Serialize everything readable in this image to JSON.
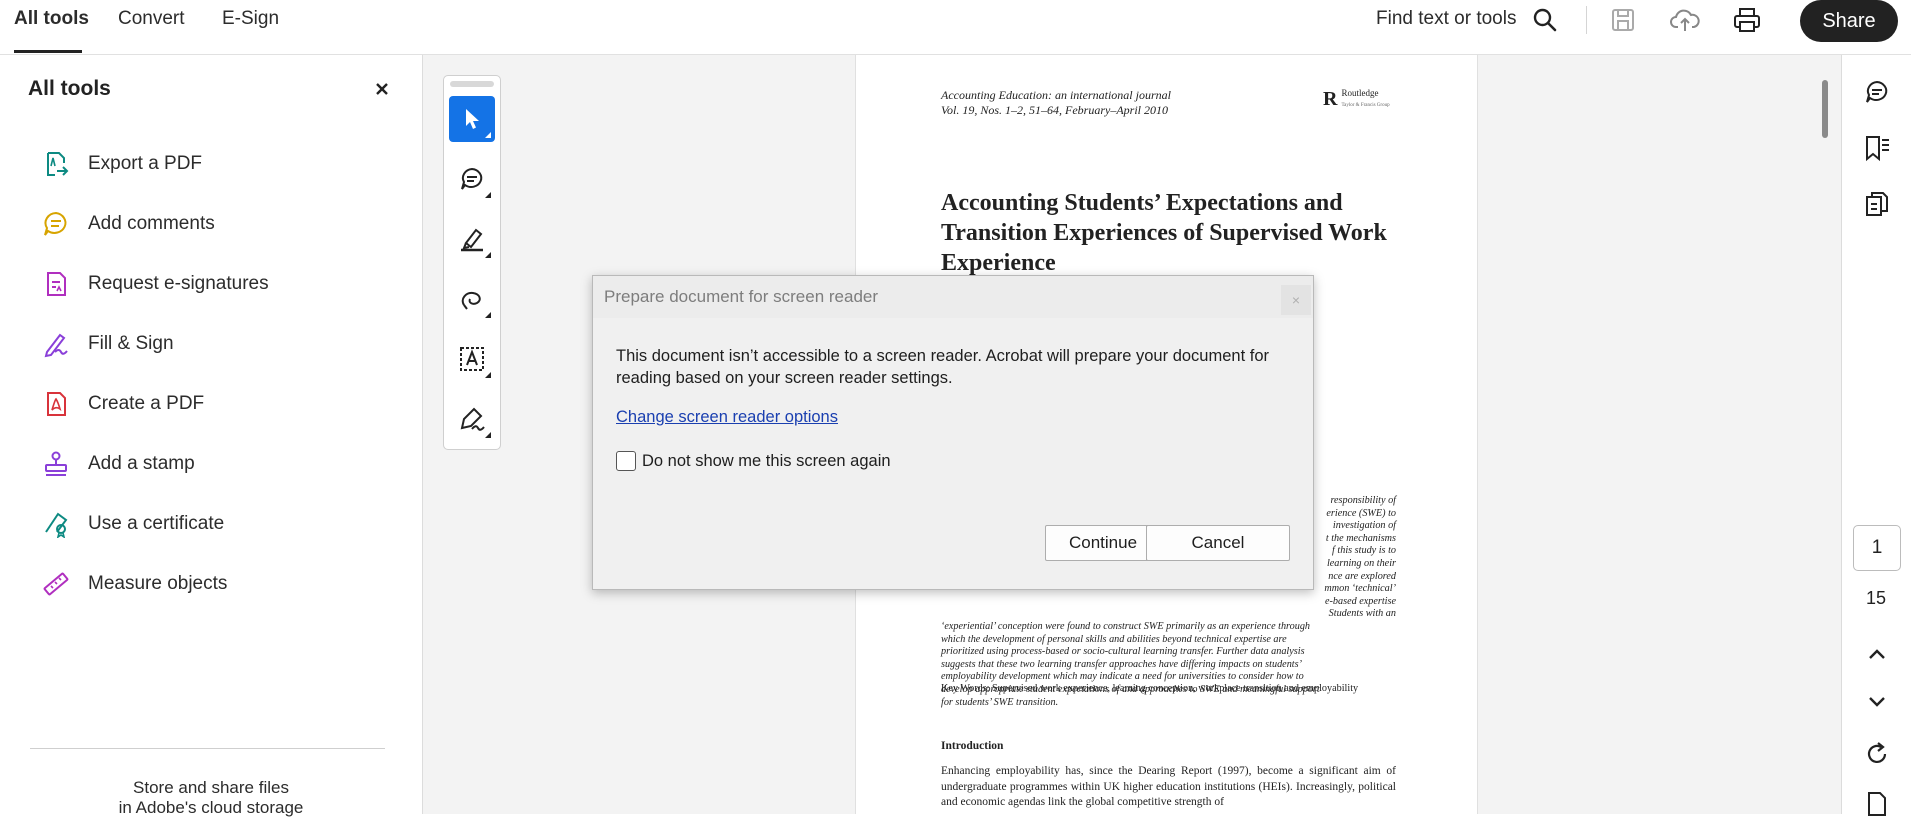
{
  "topbar": {
    "tabs": [
      "All tools",
      "Convert",
      "E-Sign"
    ],
    "find_label": "Find text or tools",
    "share_label": "Share",
    "icons": [
      "search-icon",
      "save-icon",
      "cloud-upload-icon",
      "print-icon"
    ]
  },
  "left_panel": {
    "title": "All tools",
    "tools": [
      {
        "label": "Export a PDF",
        "icon": "export-pdf-icon",
        "color": "#0d8a82"
      },
      {
        "label": "Add comments",
        "icon": "comment-icon",
        "color": "#d7a400"
      },
      {
        "label": "Request e-signatures",
        "icon": "request-esign-icon",
        "color": "#b02fbf"
      },
      {
        "label": "Fill & Sign",
        "icon": "fill-sign-icon",
        "color": "#8a3fd9"
      },
      {
        "label": "Create a PDF",
        "icon": "create-pdf-icon",
        "color": "#d8333b"
      },
      {
        "label": "Add a stamp",
        "icon": "stamp-icon",
        "color": "#8a3fd9"
      },
      {
        "label": "Use a certificate",
        "icon": "certificate-icon",
        "color": "#0d8a82"
      },
      {
        "label": "Measure objects",
        "icon": "measure-icon",
        "color": "#b02fbf"
      }
    ],
    "footer_line1": "Store and share files",
    "footer_line2": "in Adobe's cloud storage"
  },
  "document": {
    "journal_line1": "Accounting Education: an international journal",
    "journal_line2": "Vol. 19, Nos. 1–2, 51–64, February–April 2010",
    "logo_name": "Routledge",
    "logo_sub": "Taylor & Francis Group",
    "title": "Accounting Students’ Expectations and Transition Experiences of Supervised Work Experience",
    "abstract_lines": [
      "responsibility of",
      "erience (SWE) to",
      "investigation of",
      "t the mechanisms",
      "f this study is to",
      "learning on their",
      "nce are explored",
      "mmon ‘technical’",
      "e-based expertise",
      "Students with an",
      "‘experiential’ conception were found to construct SWE primarily as an experience through",
      "which the development of personal skills and abilities beyond technical expertise are",
      "prioritized using process-based or socio-cultural learning transfer. Further data analysis",
      "suggests that these two learning transfer approaches have differing impacts on students’",
      "employability development which may indicate a need for universities to consider how to",
      "develop appropriate student expectations of and approaches to SWE and meaningful support",
      "for students’ SWE transition."
    ],
    "keywords": "Key Words: Supervised work experience, learning conception, workplace transition and employability",
    "intro_heading": "Introduction",
    "intro_text": "Enhancing employability has, since the Dearing Report (1997), become a significant aim of undergraduate programmes within UK higher education institutions (HEIs). Increasingly, political and economic agendas link the global competitive strength of"
  },
  "right_rail": {
    "current_page": "1",
    "total_pages": "15"
  },
  "dialog": {
    "title": "Prepare document for screen reader",
    "close_label": "×",
    "body": "This document isn’t accessible to a screen reader. Acrobat will prepare your document for reading based on your screen reader settings.",
    "link": "Change screen reader options",
    "checkbox_label": "Do not show me this screen again",
    "continue_label": "Continue",
    "cancel_label": "Cancel"
  },
  "colors": {
    "accent": "#1473e6",
    "share_bg": "#222222",
    "link": "#1a3fb0"
  }
}
